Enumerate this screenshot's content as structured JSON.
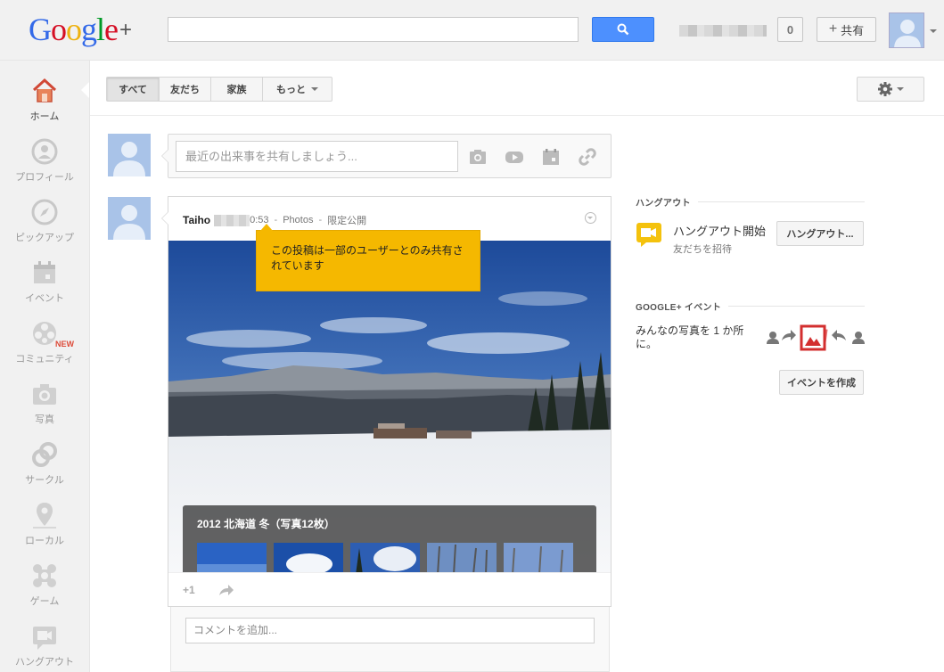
{
  "header": {
    "logo_text": "Google",
    "logo_plus": "+",
    "search_placeholder": "",
    "notification_count": "0",
    "share_label": "共有"
  },
  "nav": {
    "items": [
      {
        "label": "ホーム",
        "icon": "home-icon",
        "active": true
      },
      {
        "label": "プロフィール",
        "icon": "profile-icon"
      },
      {
        "label": "ピックアップ",
        "icon": "compass-icon"
      },
      {
        "label": "イベント",
        "icon": "calendar-icon"
      },
      {
        "label": "コミュニティ",
        "icon": "communities-icon"
      },
      {
        "label": "写真",
        "icon": "camera-icon"
      },
      {
        "label": "サークル",
        "icon": "circles-icon"
      },
      {
        "label": "ローカル",
        "icon": "location-pin-icon"
      },
      {
        "label": "ゲーム",
        "icon": "games-icon"
      },
      {
        "label": "ハングアウト",
        "icon": "hangouts-icon"
      }
    ],
    "new_badge": "NEW"
  },
  "filters": {
    "all": "すべて",
    "friends": "友だち",
    "family": "家族",
    "more": "もっと"
  },
  "sharebox": {
    "placeholder": "最近の出来事を共有しましょう..."
  },
  "post": {
    "author": "Taiho",
    "time": "0:53",
    "source": "Photos",
    "visibility": "限定公開",
    "tooltip": "この投稿は一部のユーザーとのみ共有されています",
    "album_title": "2012 北海道 冬（写真12枚）",
    "plusone": "+1",
    "comment_placeholder": "コメントを追加..."
  },
  "hangouts": {
    "title": "ハングアウト",
    "start_label": "ハングアウト開始",
    "invite_label": "友だちを招待",
    "button": "ハングアウト..."
  },
  "events": {
    "title": "GOOGLE+ イベント",
    "description": "みんなの写真を 1 か所に。",
    "button": "イベントを作成"
  },
  "colors": {
    "accent_blue": "#4d90fe",
    "tooltip_yellow": "#f5b800",
    "home_red": "#d14836"
  }
}
